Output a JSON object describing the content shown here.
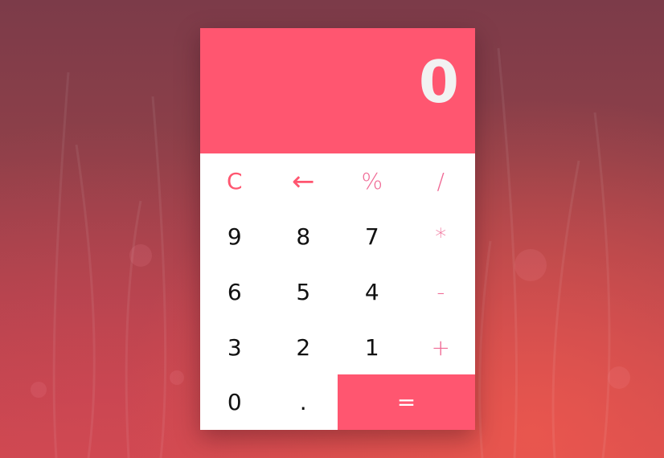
{
  "display": {
    "value": "0"
  },
  "keys": {
    "clear": "C",
    "backspace": "←",
    "percent": "%",
    "divide": "/",
    "nine": "9",
    "eight": "8",
    "seven": "7",
    "multiply": "*",
    "six": "6",
    "five": "5",
    "four": "4",
    "subtract": "-",
    "three": "3",
    "two": "2",
    "one": "1",
    "add": "+",
    "zero": "0",
    "decimal": ".",
    "equals": "="
  },
  "colors": {
    "accent": "#ff5670",
    "operator": "#f06a95",
    "display_text": "#f2f2f2",
    "keypad_bg": "#ffffff"
  },
  "icons": {
    "backspace": "left-arrow-icon"
  }
}
